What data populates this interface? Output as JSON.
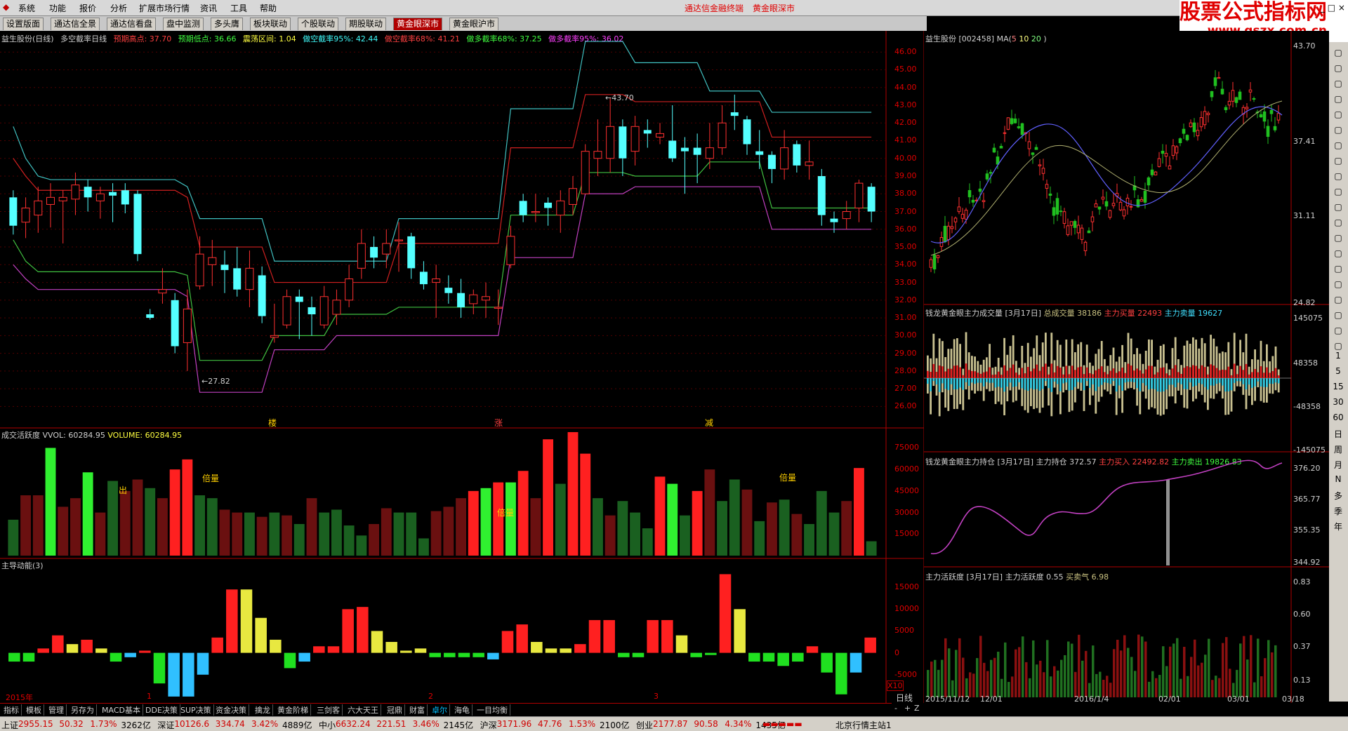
{
  "menu": {
    "items": [
      "系统",
      "功能",
      "报价",
      "分析",
      "扩展市场行情",
      "资讯",
      "工具",
      "帮助"
    ],
    "center_items": [
      "通达信金融终端",
      "黄金眼深市"
    ]
  },
  "logo": {
    "title": "股票公式指标网",
    "url_text": "www.gszx.com.cn"
  },
  "window_controls": "_ □ ×",
  "tabs": [
    "设置版面",
    "通达信全景",
    "通达信看盘",
    "盘中监测",
    "多头膺",
    "板块联动",
    "个股联动",
    "期股联动",
    "黄金眼深市",
    "黄金眼沪市"
  ],
  "active_tab": 8,
  "main_chart": {
    "header": [
      {
        "text": "益生股份(日线)",
        "color": "#d0d0d0"
      },
      {
        "text": "多空截率日线",
        "color": "#d0d0d0"
      },
      {
        "text": "预期高点: 37.70",
        "color": "#ff4040"
      },
      {
        "text": "预期低点: 36.66",
        "color": "#40ff40"
      },
      {
        "text": "震荡区间: 1.04",
        "color": "#ffff40"
      },
      {
        "text": "做空截率95%: 42.44",
        "color": "#40ffff"
      },
      {
        "text": "做空截率68%: 41.21",
        "color": "#ff4040"
      },
      {
        "text": "做多截率68%: 37.25",
        "color": "#40ff40"
      },
      {
        "text": "做多截率95%: 36.02",
        "color": "#ff40ff"
      }
    ],
    "y_ticks": [
      "46.00",
      "45.00",
      "44.00",
      "43.00",
      "42.00",
      "41.00",
      "40.00",
      "39.00",
      "38.00",
      "37.00",
      "36.00",
      "35.00",
      "34.00",
      "33.00",
      "32.00",
      "31.00",
      "30.00",
      "29.00",
      "28.00",
      "27.00",
      "26.00"
    ],
    "high_label": "43.70",
    "low_label": "27.82",
    "markers": [
      "楼",
      "涨",
      "减"
    ]
  },
  "chart_data": [
    {
      "type": "candlestick",
      "title": "益生股份(日线)",
      "ylim": [
        25.5,
        46.8
      ],
      "candles": [
        [
          37.8,
          36.2,
          38.2,
          35.7
        ],
        [
          36.4,
          37.2,
          37.8,
          35.5
        ],
        [
          36.8,
          37.6,
          38.4,
          35.8
        ],
        [
          37.4,
          37.8,
          38.6,
          36.1
        ],
        [
          37.6,
          37.8,
          38.2,
          35.2
        ],
        [
          37.7,
          38.5,
          39.2,
          36.8
        ],
        [
          38.4,
          37.8,
          38.8,
          37.0
        ],
        [
          37.6,
          38.0,
          38.4,
          36.6
        ],
        [
          38.1,
          37.9,
          38.6,
          36.4
        ],
        [
          38.2,
          37.4,
          38.6,
          36.9
        ],
        [
          38.0,
          34.6,
          38.2,
          34.2
        ],
        [
          31.2,
          31.0,
          31.5,
          30.9
        ],
        [
          32.4,
          32.6,
          33.8,
          31.8
        ],
        [
          32.0,
          29.4,
          32.4,
          29.0
        ],
        [
          29.6,
          31.5,
          32.6,
          28.0
        ],
        [
          32.8,
          34.6,
          35.6,
          32.6
        ],
        [
          34.0,
          34.4,
          35.4,
          32.8
        ],
        [
          34.0,
          33.7,
          34.8,
          32.4
        ],
        [
          33.8,
          32.6,
          35.0,
          32.2
        ],
        [
          32.6,
          33.8,
          34.8,
          31.6
        ],
        [
          33.4,
          31.1,
          33.9,
          30.7
        ],
        [
          29.9,
          30.0,
          31.8,
          29.6
        ],
        [
          30.6,
          32.2,
          32.6,
          30.4
        ],
        [
          32.2,
          31.9,
          32.6,
          29.8
        ],
        [
          31.6,
          31.2,
          32.2,
          30.0
        ],
        [
          30.6,
          32.2,
          32.8,
          30.4
        ],
        [
          31.2,
          32.0,
          32.6,
          30.6
        ],
        [
          32.0,
          33.2,
          34.0,
          31.6
        ],
        [
          33.8,
          35.2,
          36.0,
          33.2
        ],
        [
          35.0,
          34.4,
          35.6,
          33.8
        ],
        [
          34.6,
          35.2,
          36.0,
          33.8
        ],
        [
          35.4,
          35.4,
          36.4,
          33.6
        ],
        [
          35.6,
          33.8,
          35.8,
          33.2
        ],
        [
          33.6,
          32.9,
          34.2,
          32.6
        ],
        [
          33.0,
          33.2,
          34.0,
          31.0
        ],
        [
          32.7,
          32.4,
          33.4,
          31.8
        ],
        [
          32.4,
          31.6,
          33.2,
          31.0
        ],
        [
          31.8,
          32.3,
          32.6,
          31.2
        ],
        [
          32.0,
          32.2,
          33.0,
          31.0
        ],
        [
          31.6,
          31.6,
          32.6,
          30.6
        ],
        [
          34.0,
          35.6,
          36.2,
          33.8
        ],
        [
          37.6,
          36.8,
          38.0,
          36.4
        ],
        [
          37.0,
          37.0,
          38.0,
          36.4
        ],
        [
          37.5,
          37.2,
          37.8,
          36.2
        ],
        [
          36.8,
          37.6,
          38.2,
          35.8
        ],
        [
          37.4,
          38.3,
          39.0,
          36.8
        ],
        [
          38.0,
          40.4,
          40.8,
          38.4
        ],
        [
          40.0,
          40.4,
          42.2,
          39.0
        ],
        [
          40.0,
          41.8,
          43.4,
          39.2
        ],
        [
          41.8,
          40.0,
          42.2,
          39.0
        ],
        [
          40.4,
          41.8,
          42.4,
          39.6
        ],
        [
          41.6,
          41.4,
          42.2,
          40.6
        ],
        [
          41.2,
          41.4,
          42.0,
          40.8
        ],
        [
          41.0,
          40.0,
          43.0,
          39.8
        ],
        [
          40.6,
          40.4,
          41.2,
          38.0
        ],
        [
          40.6,
          40.2,
          41.4,
          38.6
        ],
        [
          40.0,
          40.6,
          42.0,
          39.4
        ],
        [
          40.6,
          42.0,
          43.0,
          40.2
        ],
        [
          42.6,
          42.4,
          43.6,
          41.6
        ],
        [
          42.2,
          40.8,
          42.4,
          40.2
        ],
        [
          40.4,
          40.2,
          41.6,
          39.4
        ],
        [
          40.2,
          39.4,
          40.4,
          38.6
        ],
        [
          39.4,
          40.6,
          41.6,
          38.8
        ],
        [
          40.8,
          39.6,
          41.0,
          39.2
        ],
        [
          39.6,
          39.8,
          41.0,
          38.8
        ],
        [
          39.0,
          36.8,
          39.4,
          36.2
        ],
        [
          36.6,
          36.4,
          37.0,
          35.8
        ],
        [
          36.6,
          37.0,
          37.6,
          36.0
        ],
        [
          37.2,
          38.6,
          38.8,
          36.4
        ],
        [
          38.4,
          37.0,
          38.6,
          36.4
        ]
      ],
      "bands": {
        "short95": [
          41.8,
          40.0,
          39.0,
          38.8,
          38.8,
          38.8,
          38.8,
          38.8,
          38.8,
          38.8,
          38.8,
          38.8,
          38.8,
          38.8,
          38.4,
          36.6,
          36.6,
          36.6,
          36.6,
          36.6,
          36.6,
          34.2,
          34.2,
          34.2,
          34.2,
          34.2,
          34.2,
          34.2,
          34.2,
          34.2,
          34.2,
          36.6,
          36.6,
          36.6,
          36.6,
          36.6,
          36.6,
          36.6,
          36.6,
          36.6,
          42.8,
          42.8,
          42.8,
          42.8,
          42.8,
          42.8,
          46.6,
          46.6,
          46.6,
          46.6,
          45.4,
          45.4,
          45.4,
          45.4,
          45.4,
          45.4,
          43.8,
          43.8,
          43.8,
          43.8,
          43.8,
          42.6,
          42.6,
          42.6,
          42.6,
          42.6,
          42.6,
          42.6,
          42.6,
          42.6
        ],
        "short68": [
          40.0,
          39.0,
          38.2,
          38.2,
          38.2,
          38.2,
          38.2,
          38.2,
          38.2,
          38.2,
          38.2,
          38.2,
          38.2,
          38.2,
          37.8,
          35.0,
          35.0,
          35.0,
          35.0,
          35.0,
          35.0,
          33.0,
          33.0,
          33.0,
          33.0,
          33.0,
          33.0,
          33.0,
          33.0,
          33.0,
          33.0,
          35.2,
          35.2,
          35.2,
          35.2,
          35.2,
          35.2,
          35.2,
          35.2,
          35.2,
          40.6,
          40.6,
          40.6,
          40.6,
          40.6,
          40.6,
          43.6,
          43.6,
          43.6,
          43.6,
          43.2,
          43.2,
          43.2,
          43.2,
          43.2,
          43.2,
          43.2,
          43.2,
          43.2,
          43.2,
          43.2,
          41.2,
          41.2,
          41.2,
          41.2,
          41.2,
          41.2,
          41.2,
          41.2,
          41.2
        ],
        "long68": [
          35.4,
          34.2,
          33.6,
          33.6,
          33.6,
          33.6,
          33.6,
          33.6,
          33.6,
          33.6,
          33.6,
          33.6,
          33.6,
          33.6,
          33.4,
          28.6,
          28.6,
          28.6,
          28.6,
          28.6,
          28.6,
          30.0,
          30.0,
          30.0,
          30.0,
          30.0,
          31.2,
          31.2,
          31.2,
          31.2,
          31.2,
          31.6,
          31.6,
          31.6,
          31.6,
          31.6,
          31.6,
          31.6,
          31.6,
          31.6,
          36.8,
          36.8,
          36.8,
          36.8,
          36.8,
          36.8,
          39.2,
          39.2,
          39.2,
          39.2,
          39.0,
          39.0,
          39.0,
          39.0,
          39.0,
          39.0,
          39.8,
          39.8,
          39.8,
          39.8,
          39.8,
          37.2,
          37.2,
          37.2,
          37.2,
          37.2,
          37.2,
          37.2,
          37.2,
          37.2
        ],
        "long95": [
          34.0,
          33.2,
          32.6,
          32.6,
          32.6,
          32.6,
          32.6,
          32.6,
          32.6,
          32.6,
          32.6,
          32.6,
          32.6,
          32.6,
          32.2,
          26.8,
          26.8,
          26.8,
          26.8,
          26.8,
          26.8,
          29.2,
          29.2,
          29.2,
          29.2,
          29.2,
          30.0,
          30.0,
          30.0,
          30.0,
          30.0,
          30.0,
          30.0,
          30.0,
          30.0,
          30.0,
          30.0,
          30.0,
          30.0,
          30.0,
          34.4,
          34.4,
          34.4,
          34.4,
          34.4,
          34.4,
          38.0,
          38.0,
          38.0,
          38.0,
          38.4,
          38.4,
          38.4,
          38.4,
          38.4,
          38.4,
          38.4,
          38.4,
          38.4,
          38.4,
          38.4,
          36.0,
          36.0,
          36.0,
          36.0,
          36.0,
          36.0,
          36.0,
          36.0,
          36.0
        ]
      }
    },
    {
      "type": "bar",
      "title": "成交活跃度",
      "ylim": [
        0,
        85000
      ],
      "values": [
        25000,
        42000,
        42000,
        75000,
        34000,
        40000,
        58000,
        30000,
        52000,
        45000,
        53000,
        47000,
        40000,
        60000,
        67000,
        42000,
        40000,
        32000,
        30000,
        30000,
        27000,
        30000,
        28000,
        22000,
        40000,
        30000,
        32000,
        21000,
        14000,
        22000,
        33000,
        30000,
        30000,
        12000,
        31000,
        34000,
        40000,
        45000,
        47000,
        51000,
        51000,
        59000,
        40000,
        81000,
        50000,
        86000,
        71000,
        40000,
        28000,
        38000,
        30000,
        19000,
        55000,
        50000,
        28000,
        45000,
        60000,
        38000,
        53000,
        46000,
        24000,
        37000,
        39000,
        29000,
        22000,
        45000,
        30000,
        38000,
        61000,
        10000
      ],
      "colors": [
        "dg",
        "dr",
        "dr",
        "lg",
        "dr",
        "dr",
        "lg",
        "dr",
        "dg",
        "dr",
        "dr",
        "dg",
        "dr",
        "r",
        "r",
        "dg",
        "dg",
        "dr",
        "dr",
        "dg",
        "dr",
        "dg",
        "dr",
        "dg",
        "dr",
        "dg",
        "dg",
        "dg",
        "dg",
        "dr",
        "dr",
        "dg",
        "dg",
        "dg",
        "dr",
        "dr",
        "dr",
        "r",
        "lg",
        "r",
        "lg",
        "r",
        "dr",
        "r",
        "dg",
        "r",
        "r",
        "dg",
        "dr",
        "dg",
        "dg",
        "dg",
        "r",
        "lg",
        "dg",
        "r",
        "dr",
        "dg",
        "dg",
        "dr",
        "dg",
        "dr",
        "dg",
        "dr",
        "dg",
        "dg",
        "dg",
        "dr",
        "r",
        "dg"
      ]
    },
    {
      "type": "bar",
      "title": "主导动能(3)",
      "ylim": [
        -10500,
        20000
      ],
      "values": [
        -2000,
        -2000,
        1000,
        4000,
        2000,
        3000,
        1000,
        -2000,
        -1000,
        500,
        -7000,
        -10000,
        -10000,
        -5000,
        3500,
        14500,
        14500,
        8000,
        3000,
        -3500,
        -2000,
        1500,
        1500,
        10000,
        10500,
        5000,
        2500,
        500,
        1000,
        -1000,
        -1000,
        -1000,
        -1000,
        -1500,
        5000,
        6500,
        2500,
        1000,
        1000,
        2000,
        7500,
        7500,
        -1000,
        -1000,
        7500,
        7500,
        4000,
        -1000,
        -500,
        18000,
        10000,
        -2000,
        -2000,
        -3000,
        -2000,
        1500,
        -4500,
        -9500,
        -4500,
        3500
      ],
      "colors": [
        "g",
        "g",
        "r",
        "r",
        "y",
        "r",
        "y",
        "g",
        "c",
        "r",
        "g",
        "c",
        "c",
        "c",
        "r",
        "r",
        "y",
        "y",
        "y",
        "g",
        "c",
        "r",
        "r",
        "r",
        "r",
        "y",
        "y",
        "y",
        "y",
        "g",
        "g",
        "g",
        "g",
        "c",
        "r",
        "r",
        "y",
        "y",
        "y",
        "r",
        "r",
        "r",
        "g",
        "g",
        "r",
        "r",
        "y",
        "g",
        "g",
        "r",
        "y",
        "g",
        "g",
        "g",
        "g",
        "r",
        "g",
        "g",
        "c",
        "r"
      ]
    },
    {
      "type": "candlestick",
      "title": "益生股份",
      "ylim": [
        24.82,
        43.7
      ],
      "ma_periods": [
        5,
        10,
        20
      ]
    },
    {
      "type": "bar",
      "title": "钱龙黄金眼主力成交量",
      "ylim": [
        -145075,
        145075
      ]
    },
    {
      "type": "line",
      "title": "钱龙黄金眼主力持仓",
      "ylim": [
        344.92,
        376.2
      ]
    },
    {
      "type": "bar",
      "title": "主力活跃度",
      "ylim": [
        0.13,
        0.83
      ]
    }
  ],
  "vol_chart": {
    "header": [
      {
        "text": "成交活跃度",
        "color": "#d0d0d0"
      },
      {
        "text": "VVOL: 60284.95",
        "color": "#d0d0d0"
      },
      {
        "text": "VOLUME: 60284.95",
        "color": "#ffff40"
      }
    ],
    "y_ticks": [
      "75000",
      "60000",
      "45000",
      "30000",
      "15000"
    ],
    "labels": [
      "出",
      "倍量",
      "倍量",
      "倍量"
    ]
  },
  "mom_chart": {
    "header": [
      {
        "text": "主导动能(3)",
        "color": "#d0d0d0"
      }
    ],
    "y_ticks": [
      "15000",
      "10000",
      "5000",
      "0",
      "-5000"
    ],
    "x_labels": [
      "2015年",
      "1",
      "2",
      "3"
    ],
    "x10": "X10"
  },
  "side_k": {
    "title": "益生股份",
    "code": "[002458]",
    "ma": "MA(",
    "ma5": "5",
    "ma10": "10",
    "ma20": "20",
    "ma_end": ")",
    "y_ticks": [
      "43.70",
      "37.41",
      "31.11",
      "24.82"
    ]
  },
  "side_vol": {
    "title": "钱龙黄金眼主力成交量 [3月17日]",
    "total_label": "总成交量",
    "total": "38186",
    "buy_label": "主力买量",
    "buy": "22493",
    "sell_label": "主力卖量",
    "sell": "19627",
    "y_ticks": [
      "145075",
      "48358",
      "-48358",
      "-145075"
    ]
  },
  "side_pos": {
    "title": "钱龙黄金眼主力持仓 [3月17日]",
    "pos_label": "主力持仓",
    "pos": "372.57",
    "buy_label": "主力买入",
    "buy": "22492.82",
    "sell_label": "主力卖出",
    "sell": "19826.83",
    "y_ticks": [
      "376.20",
      "365.77",
      "355.35",
      "344.92"
    ]
  },
  "side_act": {
    "title": "主力活跃度 [3月17日]",
    "act_label": "主力活跃度",
    "act": "0.55",
    "mood_label": "买卖气",
    "mood": "6.98",
    "y_ticks": [
      "0.83",
      "0.60",
      "0.37",
      "0.13"
    ],
    "x_labels": [
      "2015/11/12",
      "12/01",
      "2016/1/4",
      "02/01",
      "03/01",
      "03/18"
    ]
  },
  "period": {
    "label": "日线"
  },
  "bottom_tabs": [
    "指标",
    "模板",
    "管理",
    "另存为",
    "MACD基本",
    "DDE决策",
    "SUP决策",
    "资金决策",
    "擒龙",
    "黄金阶梯",
    "三剑客",
    "六大天王",
    "冠鼎",
    "财富",
    "卓尔",
    "海龟",
    "一目均衡"
  ],
  "active_bottom_tab": 14,
  "scroll_ctrls": [
    "-",
    "+",
    "Z"
  ],
  "right_tools": [
    "1",
    "5",
    "15",
    "30",
    "60",
    "日",
    "周",
    "月",
    "N",
    "多",
    "季",
    "年"
  ],
  "status": [
    {
      "name": "上证",
      "val": "2955.15",
      "chg": "50.32",
      "pct": "1.73%",
      "amt": "3262亿"
    },
    {
      "name": "深证",
      "val": "10126.6",
      "chg": "334.74",
      "pct": "3.42%",
      "amt": "4889亿"
    },
    {
      "name": "中小",
      "val": "6632.24",
      "chg": "221.51",
      "pct": "3.46%",
      "amt": "2145亿"
    },
    {
      "name": "沪深",
      "val": "3171.96",
      "chg": "47.76",
      "pct": "1.53%",
      "amt": "2100亿"
    },
    {
      "name": "创业",
      "val": "2177.87",
      "chg": "90.58",
      "pct": "4.34%",
      "amt": "1435亿"
    }
  ],
  "status_right": "北京行情主站1"
}
